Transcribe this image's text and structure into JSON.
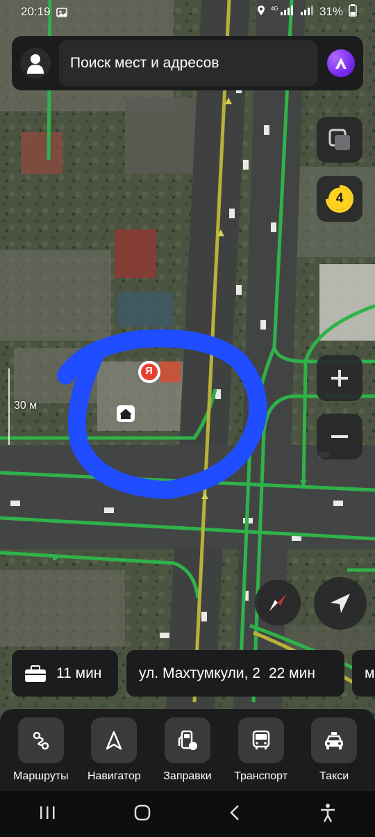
{
  "status": {
    "time": "20:19",
    "battery": "31%"
  },
  "search": {
    "placeholder": "Поиск мест и адресов"
  },
  "map": {
    "scale_label": "30 м",
    "traffic_level": "4",
    "poi_yandex_letter": "Я"
  },
  "chips": [
    {
      "label": "11 мин"
    },
    {
      "address": "ул. Махтумкули, 2",
      "time": "22 мин"
    },
    {
      "label": "м"
    }
  ],
  "bottom_nav": [
    {
      "label": "Маршруты",
      "icon": "routes-icon"
    },
    {
      "label": "Навигатор",
      "icon": "navigator-icon"
    },
    {
      "label": "Заправки",
      "icon": "fuel-icon"
    },
    {
      "label": "Транспорт",
      "icon": "bus-icon"
    },
    {
      "label": "Такси",
      "icon": "taxi-icon"
    }
  ],
  "colors": {
    "accent_alice": "#8a3ffc",
    "traffic_badge": "#ffd21f",
    "road_green": "#2fb24a",
    "road_yellow": "#b8b13a",
    "circle_blue": "#1f4dff"
  }
}
